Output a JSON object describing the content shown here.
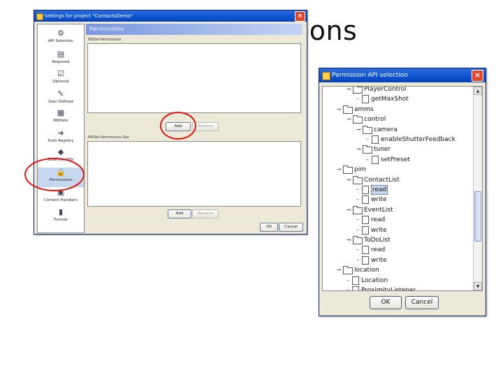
{
  "slide": {
    "title": "issions"
  },
  "settings_window": {
    "title": "Settings for project \"ContactsDemo\"",
    "close_glyph": "×",
    "sidebar": [
      {
        "label": "API Selection",
        "icon": "api-icon",
        "glyph": "⚙"
      },
      {
        "label": "Required",
        "icon": "clipboard-icon",
        "glyph": "▤"
      },
      {
        "label": "Optional",
        "icon": "checklist-icon",
        "glyph": "☑"
      },
      {
        "label": "User Defined",
        "icon": "tools-icon",
        "glyph": "✎"
      },
      {
        "label": "MIDlets",
        "icon": "midlets-icon",
        "glyph": "▦"
      },
      {
        "label": "Push Registry",
        "icon": "push-icon",
        "glyph": "➜"
      },
      {
        "label": "External APIs",
        "icon": "books-icon",
        "glyph": "◆"
      },
      {
        "label": "Permissions",
        "icon": "lock-icon",
        "glyph": "🔒",
        "selected": true
      },
      {
        "label": "Content Handlers",
        "icon": "content-icon",
        "glyph": "▣"
      },
      {
        "label": "Format",
        "icon": "format-icon",
        "glyph": "▮"
      }
    ],
    "panel_header": "Permissions",
    "required_label": "MIDlet-Permissions",
    "optional_label": "MIDlet-Permissions-Opt",
    "add_label": "Add",
    "remove_label": "Remove",
    "ok_label": "OK",
    "cancel_label": "Cancel"
  },
  "api_dialog": {
    "title": "Permission API selection",
    "close_glyph": "×",
    "tree": [
      {
        "label": "PlayerControl",
        "kind": "folder",
        "depth": 2,
        "expanded": true
      },
      {
        "label": "getMaxShot",
        "kind": "file",
        "depth": 3
      },
      {
        "label": "amms",
        "kind": "folder",
        "depth": 1,
        "expanded": true
      },
      {
        "label": "control",
        "kind": "folder",
        "depth": 2,
        "expanded": true
      },
      {
        "label": "camera",
        "kind": "folder",
        "depth": 3,
        "expanded": true
      },
      {
        "label": "enableShutterFeedback",
        "kind": "file",
        "depth": 4
      },
      {
        "label": "tuner",
        "kind": "folder",
        "depth": 3,
        "expanded": true
      },
      {
        "label": "setPreset",
        "kind": "file",
        "depth": 4
      },
      {
        "label": "pim",
        "kind": "folder",
        "depth": 1,
        "expanded": true
      },
      {
        "label": "ContactList",
        "kind": "folder",
        "depth": 2,
        "expanded": true
      },
      {
        "label": "read",
        "kind": "file",
        "depth": 3,
        "selected": true
      },
      {
        "label": "write",
        "kind": "file",
        "depth": 3
      },
      {
        "label": "EventList",
        "kind": "folder",
        "depth": 2,
        "expanded": true
      },
      {
        "label": "read",
        "kind": "file",
        "depth": 3
      },
      {
        "label": "write",
        "kind": "file",
        "depth": 3
      },
      {
        "label": "ToDoList",
        "kind": "folder",
        "depth": 2,
        "expanded": true
      },
      {
        "label": "read",
        "kind": "file",
        "depth": 3
      },
      {
        "label": "write",
        "kind": "file",
        "depth": 3
      },
      {
        "label": "location",
        "kind": "folder",
        "depth": 1,
        "expanded": true
      },
      {
        "label": "Location",
        "kind": "file",
        "depth": 2
      },
      {
        "label": "ProximityListener",
        "kind": "file",
        "depth": 2
      }
    ],
    "ok_label": "OK",
    "cancel_label": "Cancel"
  },
  "annotation_color": "#e01010"
}
